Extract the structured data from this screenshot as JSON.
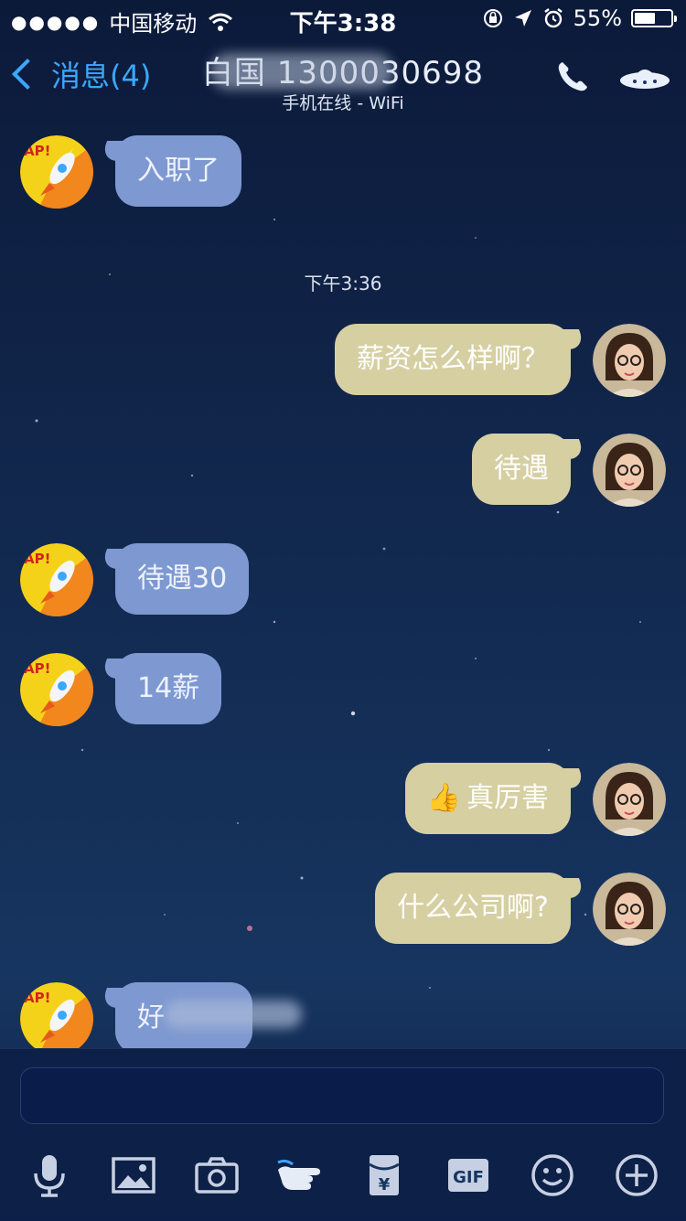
{
  "status_bar": {
    "signal": "●●●●●",
    "carrier": "中国移动",
    "time": "下午3:38",
    "battery": "55%",
    "battery_level": 0.55
  },
  "nav": {
    "back_label": "消息(4)",
    "title": "白国  1300030698",
    "subtitle": "手机在线 - WiFi"
  },
  "chat": {
    "timestamp": "下午3:36",
    "messages": [
      {
        "side": "in",
        "text": "入职了"
      },
      {
        "side": "out",
        "text": "薪资怎么样啊？"
      },
      {
        "side": "out",
        "text": "待遇"
      },
      {
        "side": "in",
        "text": "待遇30"
      },
      {
        "side": "in",
        "text": "14薪"
      },
      {
        "side": "out",
        "text": "真厉害",
        "emoji": "👍"
      },
      {
        "side": "out",
        "text": "什么公司啊?"
      },
      {
        "side": "in",
        "text": "好"
      }
    ]
  },
  "input": {
    "value": "",
    "placeholder": ""
  },
  "toolbar": {
    "icons": [
      "microphone-icon",
      "image-icon",
      "camera-icon",
      "poke-icon",
      "red-packet-icon",
      "gif-icon",
      "emoji-icon",
      "plus-icon"
    ],
    "gif_label": "GIF",
    "yen_label": "¥"
  },
  "colors": {
    "accent": "#3ba7ff",
    "incoming_bubble": "#7e99d1",
    "outgoing_bubble": "#d6cfa2"
  }
}
